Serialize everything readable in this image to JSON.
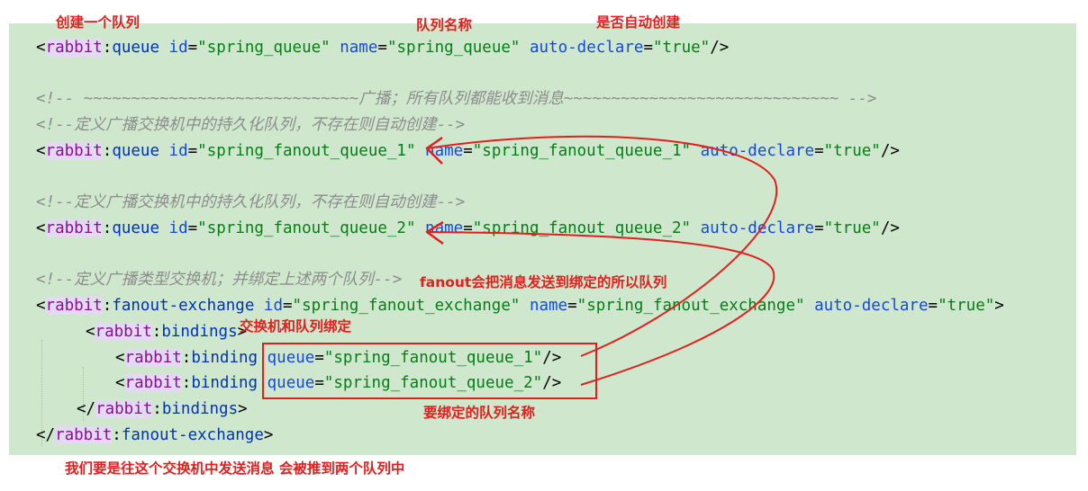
{
  "annotations": {
    "create_queue": "创建一个队列",
    "queue_name": "队列名称",
    "auto_create": "是否自动创建",
    "fanout_send": "fanout会把消息发送到绑定的所以队列",
    "bind_exchange_queue": "交换机和队列绑定",
    "bound_queue_names": "要绑定的队列名称",
    "bottom_note": "我们要是往这个交换机中发送消息 会被推到两个队列中"
  },
  "code": {
    "queue1": {
      "ns": "rabbit",
      "tag": "queue",
      "a1": "id",
      "v1": "\"spring_queue\"",
      "a2": "name",
      "v2": "\"spring_queue\"",
      "a3": "auto-declare",
      "v3": "\"true\""
    },
    "comment_broadcast": "<!-- ~~~~~~~~~~~~~~~~~~~~~~~~~~~~~广播；所有队列都能收到消息~~~~~~~~~~~~~~~~~~~~~~~~~~~~~ -->",
    "comment_durable_1": "<!--定义广播交换机中的持久化队列，不存在则自动创建-->",
    "fanout_q1": {
      "ns": "rabbit",
      "tag": "queue",
      "a1": "id",
      "v1": "\"spring_fanout_queue_1\"",
      "a2": "name",
      "v2": "\"spring_fanout_queue_1\"",
      "a3": "auto-declare",
      "v3": "\"true\""
    },
    "comment_durable_2": "<!--定义广播交换机中的持久化队列，不存在则自动创建-->",
    "fanout_q2": {
      "ns": "rabbit",
      "tag": "queue",
      "a1": "id",
      "v1": "\"spring_fanout_queue_2\"",
      "a2": "name",
      "v2": "\"spring_fanout_queue_2\"",
      "a3": "auto-declare",
      "v3": "\"true\""
    },
    "comment_exchange": "<!--定义广播类型交换机；并绑定上述两个队列-->",
    "exchange": {
      "ns": "rabbit",
      "tag": "fanout-exchange",
      "a1": "id",
      "v1": "\"spring_fanout_exchange\"",
      "a2": "name",
      "v2": "\"spring_fanout_exchange\"",
      "a3": "auto-declare",
      "v3": "\"true\""
    },
    "bindings_open": {
      "ns": "rabbit",
      "tag": "bindings"
    },
    "binding1": {
      "ns": "rabbit",
      "tag": "binding",
      "a1": "queue",
      "v1": "\"spring_fanout_queue_1\""
    },
    "binding2": {
      "ns": "rabbit",
      "tag": "binding",
      "a1": "queue",
      "v1": "\"spring_fanout_queue_2\""
    },
    "bindings_close": {
      "ns": "rabbit",
      "tag": "bindings"
    },
    "exchange_close": {
      "ns": "rabbit",
      "tag": "fanout-exchange"
    }
  },
  "colors": {
    "editor_bg": "#cfe8cd",
    "namespace": "#871094",
    "tag": "#0033b3",
    "attribute": "#174ad4",
    "string": "#067d17",
    "comment": "#8c8c8c",
    "annotation": "#e0201f"
  }
}
